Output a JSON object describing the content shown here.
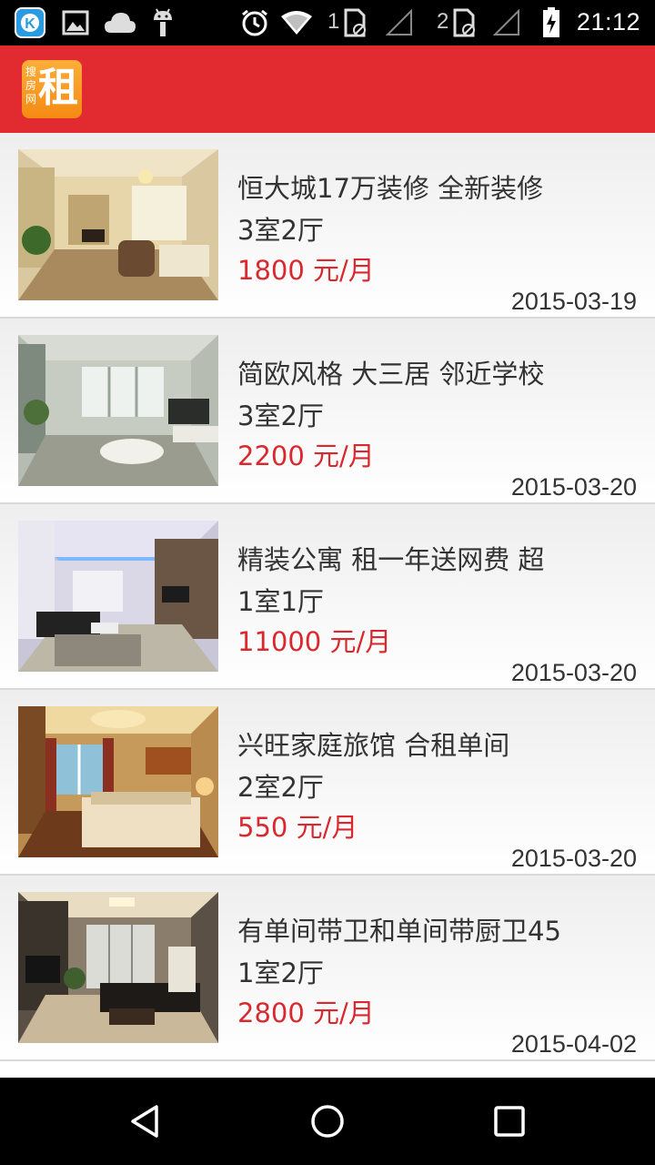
{
  "status_bar": {
    "time": "21:12",
    "sim1_label": "1",
    "sim2_label": "2",
    "icons": [
      "k-app-icon",
      "gallery-icon",
      "cloud-icon",
      "android-icon",
      "alarm-icon",
      "wifi-icon",
      "sim1-icon",
      "signal-icon",
      "sim2-icon",
      "signal-icon",
      "battery-icon"
    ]
  },
  "app_bar": {
    "logo_small_text": "搜房网",
    "logo_big_text": "租",
    "background_color": "#e12b30"
  },
  "listings": [
    {
      "title": "恒大城17万装修 全新装修",
      "rooms": "3室2厅",
      "price": "1800 元/月",
      "date": "2015-03-19"
    },
    {
      "title": "简欧风格 大三居 邻近学校",
      "rooms": "3室2厅",
      "price": "2200 元/月",
      "date": "2015-03-20"
    },
    {
      "title": "精装公寓 租一年送网费 超",
      "rooms": "1室1厅",
      "price": "11000 元/月",
      "date": "2015-03-20"
    },
    {
      "title": "兴旺家庭旅馆 合租单间",
      "rooms": "2室2厅",
      "price": "550 元/月",
      "date": "2015-03-20"
    },
    {
      "title": "有单间带卫和单间带厨卫45",
      "rooms": "1室2厅",
      "price": "2800 元/月",
      "date": "2015-04-02"
    }
  ],
  "colors": {
    "accent": "#e12b30",
    "price": "#d9292e"
  },
  "nav_bar": {
    "icons": [
      "back-icon",
      "home-icon",
      "recents-icon"
    ]
  }
}
